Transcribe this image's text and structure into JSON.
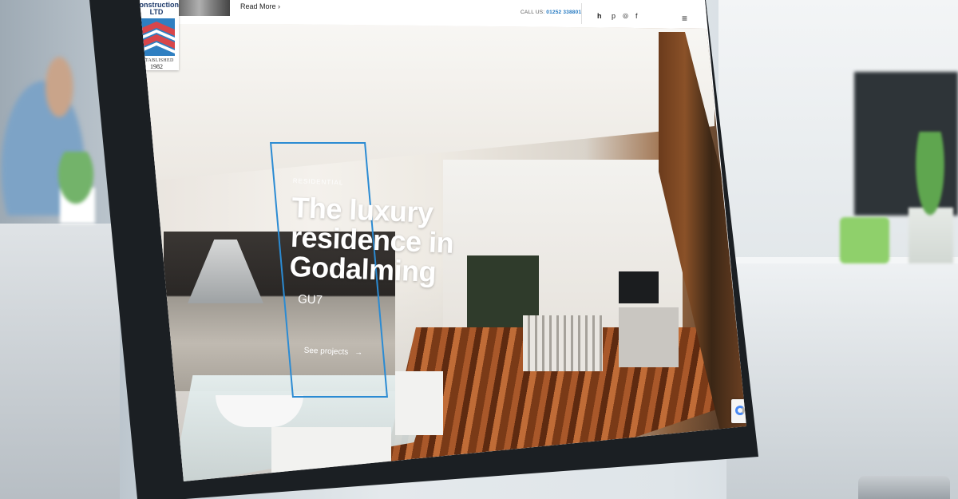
{
  "site": {
    "logo": {
      "name_line1": "Construction",
      "name_line2": "LTD",
      "established": "ESTABLISHED",
      "year": "1982",
      "colors": {
        "blue": "#2f7fc1",
        "red": "#d8464a",
        "white": "#ffffff"
      }
    },
    "header": {
      "news_link": "Read More ›",
      "call_label": "CALL US:",
      "call_number": "01252 338801",
      "social_icons": [
        "houzz-icon",
        "pinterest-icon",
        "instagram-icon",
        "facebook-icon"
      ],
      "social_glyphs": [
        "h",
        "p",
        "◎",
        "f"
      ],
      "menu_glyph": "≡"
    },
    "hero": {
      "category": "RESIDENTIAL",
      "title": "The luxury residence in Godalming",
      "location_code": "GU7",
      "link": "See projects",
      "link_arrow": "→",
      "accent_color": "#2b8bd3"
    }
  }
}
